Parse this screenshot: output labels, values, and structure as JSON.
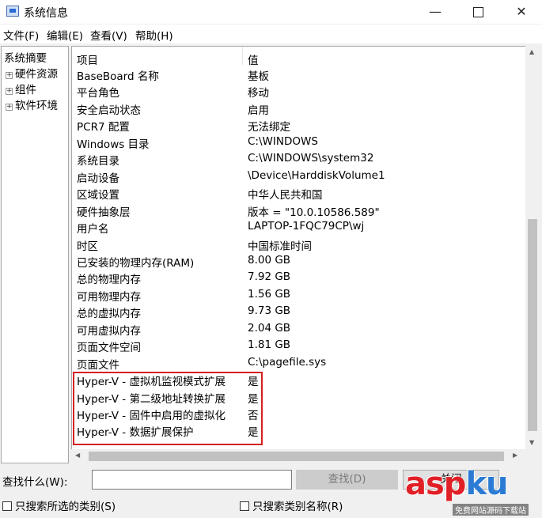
{
  "window": {
    "title": "系统信息",
    "icon": "system-info-icon"
  },
  "menu": [
    "文件(F)",
    "编辑(E)",
    "查看(V)",
    "帮助(H)"
  ],
  "tree": {
    "root": "系统摘要",
    "children": [
      "硬件资源",
      "组件",
      "软件环境"
    ]
  },
  "table": {
    "headers": {
      "item": "项目",
      "value": "值"
    },
    "rows": [
      {
        "item": "BaseBoard 名称",
        "value": "基板"
      },
      {
        "item": "平台角色",
        "value": "移动"
      },
      {
        "item": "安全启动状态",
        "value": "启用"
      },
      {
        "item": "PCR7 配置",
        "value": "无法绑定"
      },
      {
        "item": "Windows 目录",
        "value": "C:\\WINDOWS"
      },
      {
        "item": "系统目录",
        "value": "C:\\WINDOWS\\system32"
      },
      {
        "item": "启动设备",
        "value": "\\Device\\HarddiskVolume1"
      },
      {
        "item": "区域设置",
        "value": "中华人民共和国"
      },
      {
        "item": "硬件抽象层",
        "value": "版本 = \"10.0.10586.589\""
      },
      {
        "item": "用户名",
        "value": "LAPTOP-1FQC79CP\\wj"
      },
      {
        "item": "时区",
        "value": "中国标准时间"
      },
      {
        "item": "已安装的物理内存(RAM)",
        "value": "8.00 GB"
      },
      {
        "item": "总的物理内存",
        "value": "7.92 GB"
      },
      {
        "item": "可用物理内存",
        "value": "1.56 GB"
      },
      {
        "item": "总的虚拟内存",
        "value": "9.73 GB"
      },
      {
        "item": "可用虚拟内存",
        "value": "2.04 GB"
      },
      {
        "item": "页面文件空间",
        "value": "1.81 GB"
      },
      {
        "item": "页面文件",
        "value": "C:\\pagefile.sys"
      },
      {
        "item": "Hyper-V - 虚拟机监视模式扩展",
        "value": "是"
      },
      {
        "item": "Hyper-V - 第二级地址转换扩展",
        "value": "是"
      },
      {
        "item": "Hyper-V - 固件中启用的虚拟化",
        "value": "否"
      },
      {
        "item": "Hyper-V - 数据扩展保护",
        "value": "是"
      }
    ]
  },
  "search": {
    "label": "查找什么(W):",
    "value": "",
    "find_button": "查找(D)",
    "close_button": "关闭",
    "checkbox_selected": "只搜索所选的类别(S)",
    "checkbox_names": "只搜索类别名称(R)"
  },
  "watermark": {
    "logo": "aspku",
    "logo_main": "asp",
    "logo_accent": "ku",
    "sub": "免费网站源码下载站"
  },
  "colors": {
    "highlight_border": "#d62020",
    "watermark_red": "#e11f26",
    "watermark_blue": "#2b7bd5"
  }
}
